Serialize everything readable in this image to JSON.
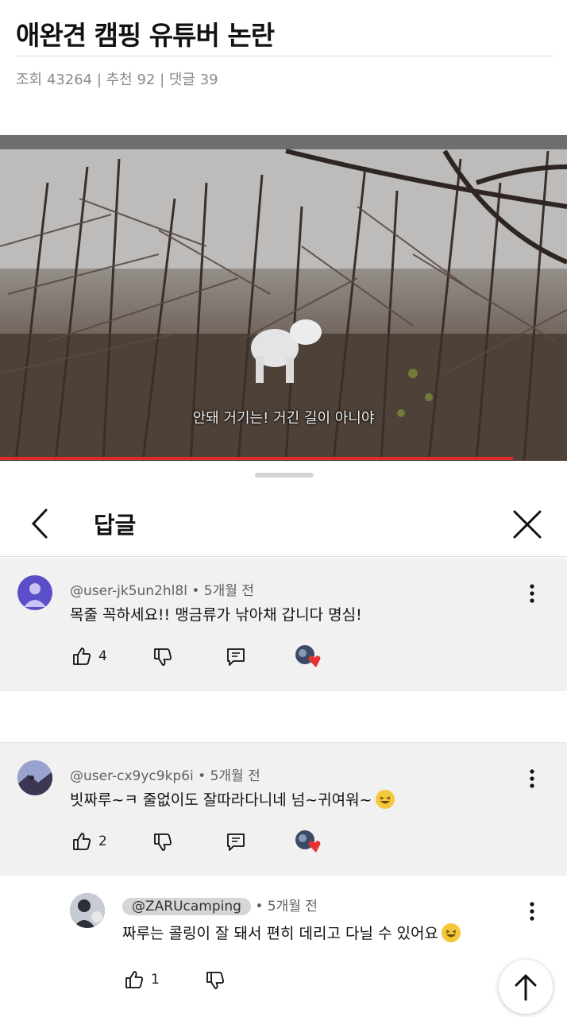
{
  "post": {
    "title": "애완견 캠핑 유튜버 논란",
    "meta": "조회 43264 | 추천 92 | 댓글 39"
  },
  "video": {
    "caption": "안돼 거기는! 거긴 길이 아니야",
    "progress": 0.905
  },
  "sheet": {
    "title": "답글"
  },
  "comments": [
    {
      "handle": "@user-jk5un2hl8l",
      "time": "5개월 전",
      "text": "목줄 꼭하세요!!  맹금류가  낚아채 갑니다  명심!",
      "likes": "4",
      "creator_hearted": true
    },
    {
      "handle": "@user-cx9yc9kp6i",
      "time": "5개월 전",
      "text": "빗짜루~ㅋ 줄없이도 잘따라다니네 넘~귀여워~",
      "likes": "2",
      "creator_hearted": true,
      "emoji": "grinning-squinting-face"
    },
    {
      "handle": "@ZARUcamping",
      "time": "5개월 전",
      "text": "짜루는 콜링이 잘 돼서 편히 데리고 다닐 수 있어요",
      "likes": "1",
      "is_creator": true,
      "emoji": "grinning-squinting-face"
    }
  ],
  "colors": {
    "accent_red": "#e02b2b",
    "heart": "#e8322f",
    "comment_bg": "#f1f1f1"
  }
}
